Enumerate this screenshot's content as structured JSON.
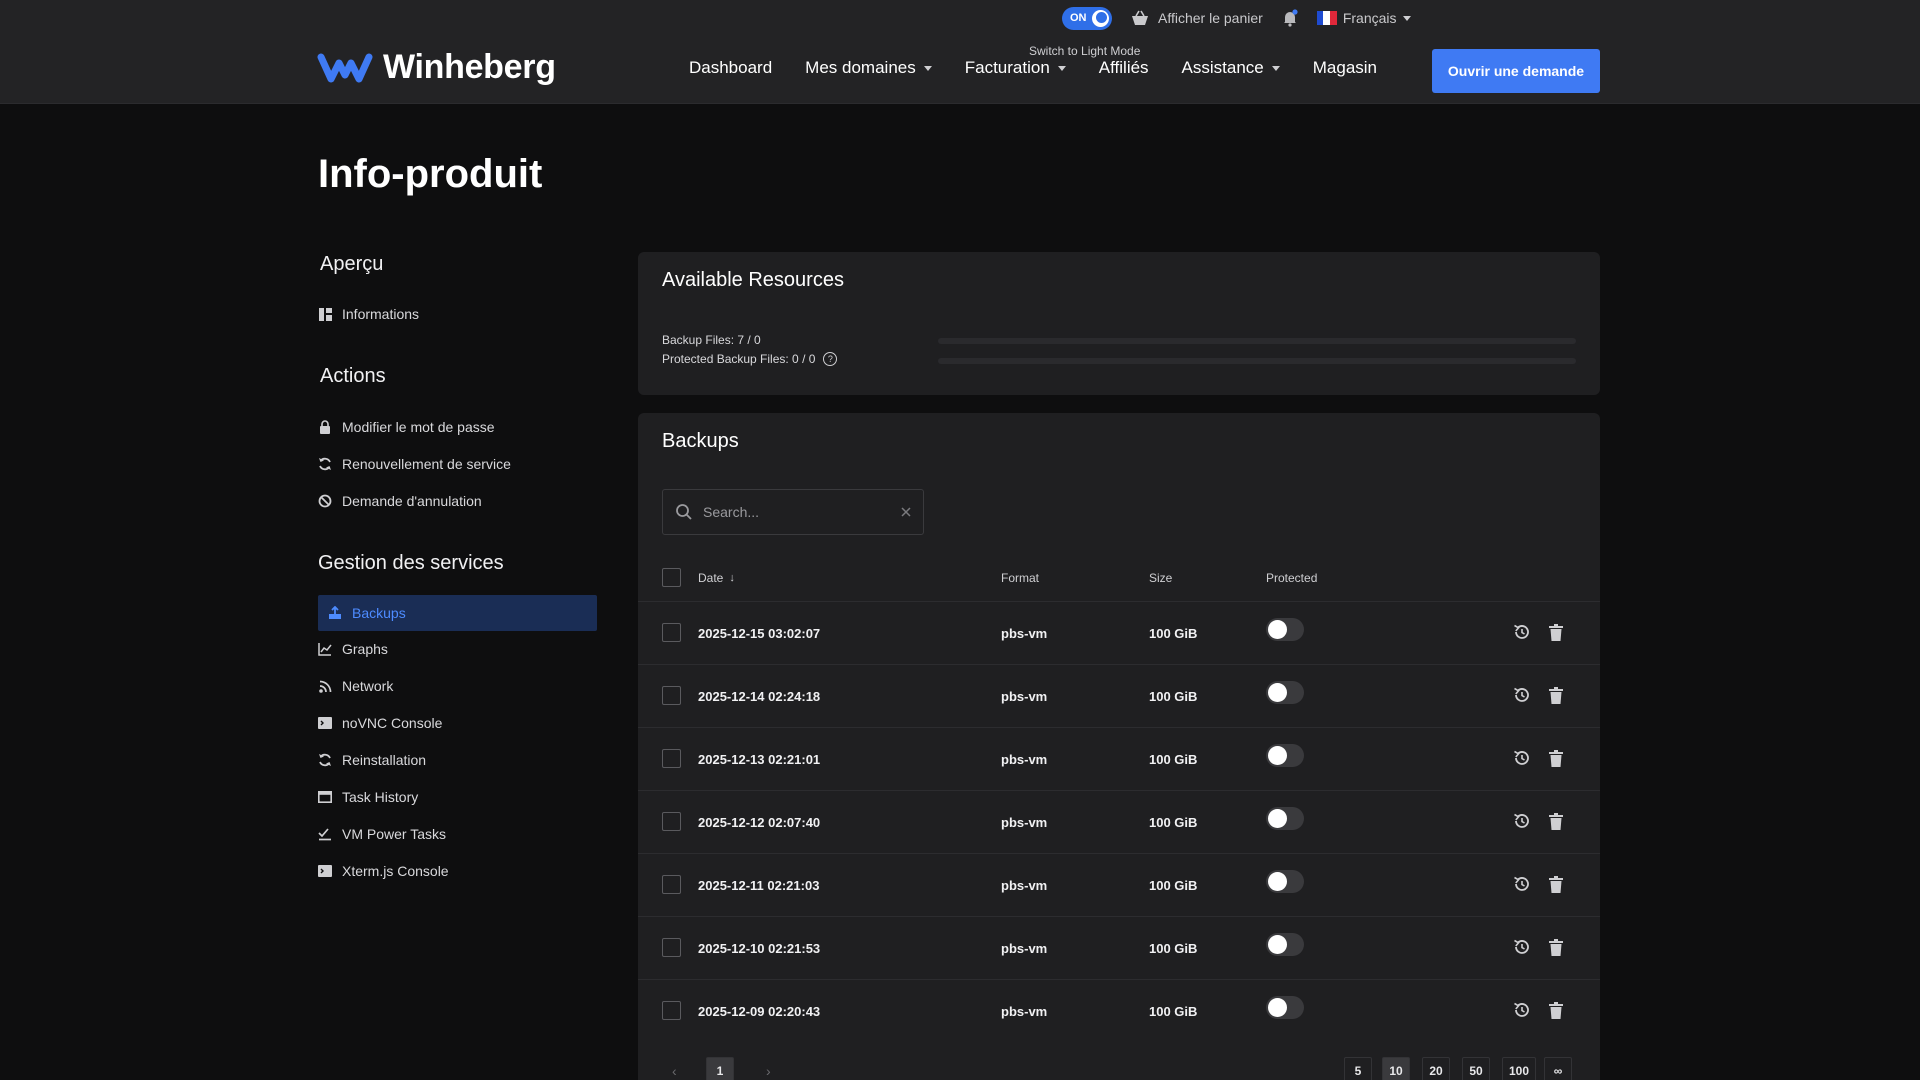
{
  "header": {
    "theme_toggle": {
      "label": "ON",
      "tooltip": "Switch to Light Mode"
    },
    "cart_label": "Afficher le panier",
    "language": {
      "label": "Français",
      "flag_colors": [
        "#1f4bd1",
        "#ffffff",
        "#e0283a"
      ]
    },
    "logo_text": "Winheberg",
    "nav": [
      {
        "label": "Dashboard",
        "dropdown": false
      },
      {
        "label": "Mes domaines",
        "dropdown": true
      },
      {
        "label": "Facturation",
        "dropdown": true
      },
      {
        "label": "Affiliés",
        "dropdown": false
      },
      {
        "label": "Assistance",
        "dropdown": true
      },
      {
        "label": "Magasin",
        "dropdown": false
      }
    ],
    "cta_label": "Ouvrir une demande"
  },
  "page_title": "Info-produit",
  "sidebar": {
    "overview": {
      "heading": "Aperçu",
      "items": [
        {
          "label": "Informations",
          "icon": "grid-icon"
        }
      ]
    },
    "actions": {
      "heading": "Actions",
      "items": [
        {
          "label": "Modifier le mot de passe",
          "icon": "lock-icon"
        },
        {
          "label": "Renouvellement de service",
          "icon": "refresh-icon"
        },
        {
          "label": "Demande d'annulation",
          "icon": "ban-icon"
        }
      ]
    },
    "services": {
      "heading": "Gestion des services",
      "items": [
        {
          "label": "Backups",
          "icon": "backup-icon",
          "active": true
        },
        {
          "label": "Graphs",
          "icon": "chart-icon"
        },
        {
          "label": "Network",
          "icon": "rss-icon"
        },
        {
          "label": "noVNC Console",
          "icon": "console-icon"
        },
        {
          "label": "Reinstallation",
          "icon": "refresh-icon"
        },
        {
          "label": "Task History",
          "icon": "window-icon"
        },
        {
          "label": "VM Power Tasks",
          "icon": "checklist-icon"
        },
        {
          "label": "Xterm.js Console",
          "icon": "console-icon"
        }
      ]
    }
  },
  "resources": {
    "title": "Available Resources",
    "items": [
      {
        "label": "Backup Files: 7 / 0",
        "fill_fraction": 0
      },
      {
        "label": "Protected Backup Files: 0 / 0",
        "fill_fraction": 0,
        "help": true
      }
    ]
  },
  "backups": {
    "title": "Backups",
    "search_placeholder": "Search...",
    "columns": {
      "date": "Date",
      "format": "Format",
      "size": "Size",
      "protected": "Protected"
    },
    "rows": [
      {
        "date": "2025-12-15 03:02:07",
        "format": "pbs-vm",
        "size": "100 GiB",
        "protected": false
      },
      {
        "date": "2025-12-14 02:24:18",
        "format": "pbs-vm",
        "size": "100 GiB",
        "protected": false
      },
      {
        "date": "2025-12-13 02:21:01",
        "format": "pbs-vm",
        "size": "100 GiB",
        "protected": false
      },
      {
        "date": "2025-12-12 02:07:40",
        "format": "pbs-vm",
        "size": "100 GiB",
        "protected": false
      },
      {
        "date": "2025-12-11 02:21:03",
        "format": "pbs-vm",
        "size": "100 GiB",
        "protected": false
      },
      {
        "date": "2025-12-10 02:21:53",
        "format": "pbs-vm",
        "size": "100 GiB",
        "protected": false
      },
      {
        "date": "2025-12-09 02:20:43",
        "format": "pbs-vm",
        "size": "100 GiB",
        "protected": false
      }
    ],
    "pagination": {
      "prev": "‹",
      "next": "›",
      "current_page": "1",
      "page_sizes": [
        "5",
        "10",
        "20",
        "50",
        "100",
        "∞"
      ],
      "selected_size": "10"
    }
  }
}
